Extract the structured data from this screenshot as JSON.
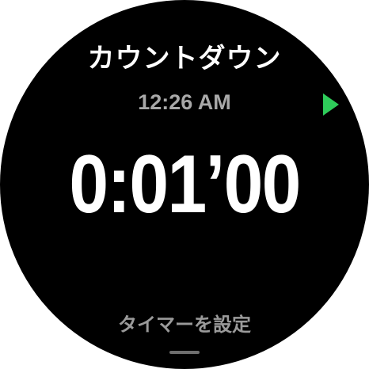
{
  "screen": {
    "title": "カウントダウン",
    "current_time": "12:26 AM",
    "countdown_value": "0:01’00",
    "set_timer_label": "タイマーを設定"
  },
  "icons": {
    "play": "play-icon",
    "handle": "drag-handle"
  },
  "colors": {
    "background": "#000000",
    "primary_text": "#ffffff",
    "secondary_text": "#a8a8a8",
    "accent": "#2ecc5a"
  }
}
